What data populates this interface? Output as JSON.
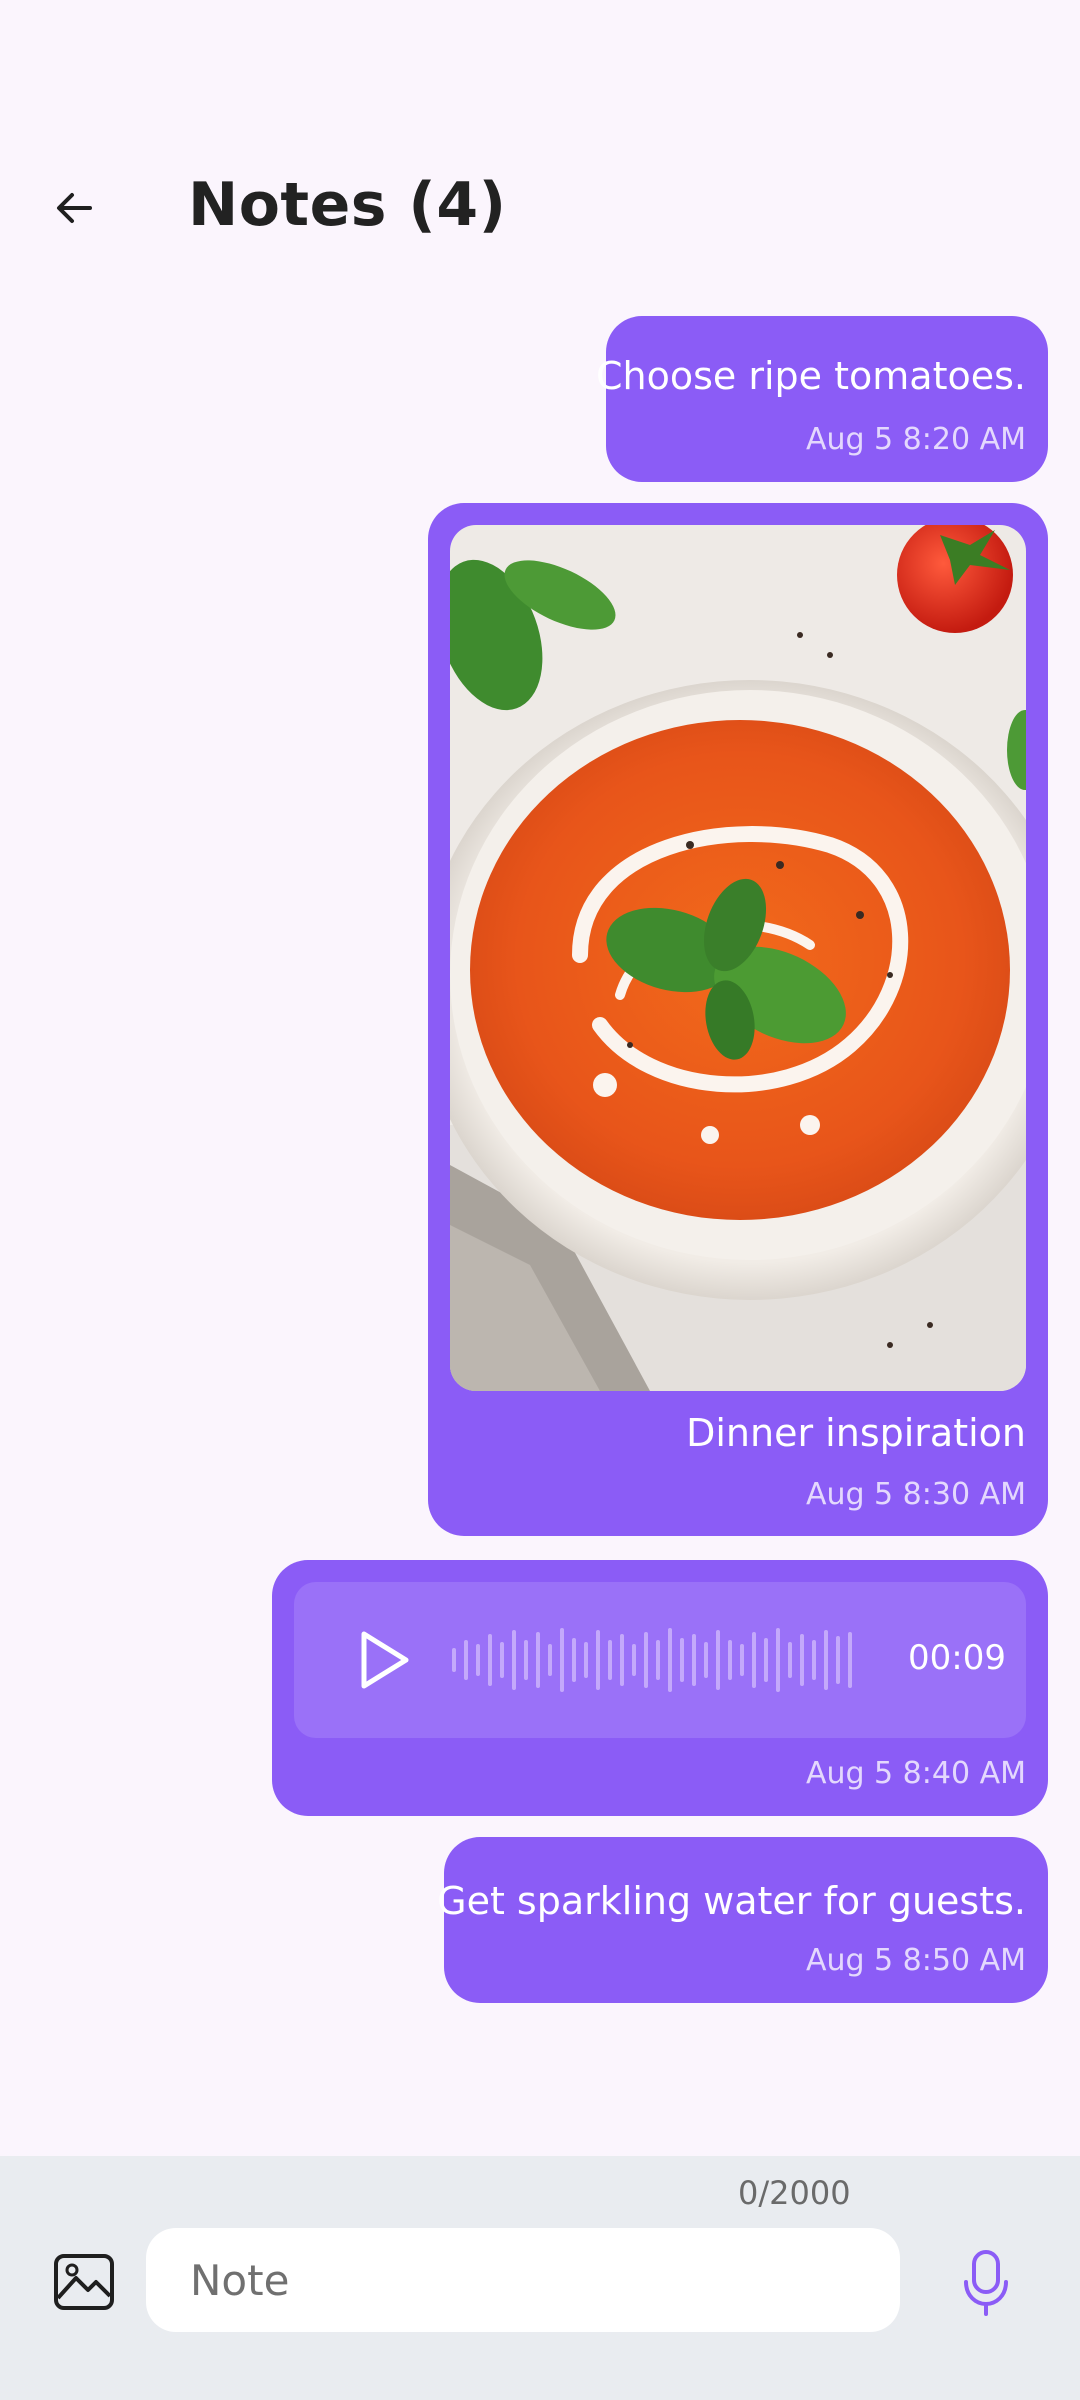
{
  "header": {
    "title": "Notes (4)",
    "back_icon": "arrow-left-icon"
  },
  "notes": [
    {
      "type": "text",
      "text": "Choose ripe tomatoes.",
      "time": "Aug 5 8:20 AM"
    },
    {
      "type": "image",
      "text": "Dinner inspiration",
      "time": "Aug 5 8:30 AM",
      "image": "tomato-soup-bowl-photo"
    },
    {
      "type": "audio",
      "duration": "00:09",
      "time": "Aug 5 8:40 AM",
      "play_icon": "play-icon"
    },
    {
      "type": "text",
      "text": "Get sparkling water for guests.",
      "time": "Aug 5 8:50 AM"
    }
  ],
  "composer": {
    "counter": "0/2000",
    "placeholder": "Note",
    "image_icon": "image-icon",
    "mic_icon": "microphone-icon"
  },
  "colors": {
    "background": "#fbf5fd",
    "bubble": "#8b5cf6",
    "audio_panel": "#9a71f8",
    "composer_bar": "#e9ecf0",
    "accent": "#8b5cf6"
  }
}
